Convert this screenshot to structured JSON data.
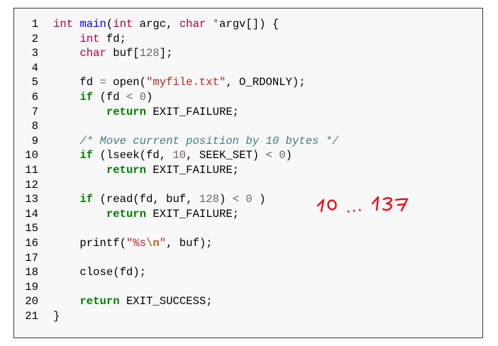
{
  "code": {
    "lines": [
      {
        "n": "1",
        "tokens": [
          {
            "t": "int",
            "c": "t-type"
          },
          {
            "t": " ",
            "c": ""
          },
          {
            "t": "main",
            "c": "t-fn"
          },
          {
            "t": "(",
            "c": ""
          },
          {
            "t": "int",
            "c": "t-type"
          },
          {
            "t": " argc, ",
            "c": ""
          },
          {
            "t": "char",
            "c": "t-type"
          },
          {
            "t": " ",
            "c": ""
          },
          {
            "t": "*",
            "c": "t-op"
          },
          {
            "t": "argv[]) {",
            "c": ""
          }
        ]
      },
      {
        "n": "2",
        "tokens": [
          {
            "t": "    ",
            "c": ""
          },
          {
            "t": "int",
            "c": "t-type"
          },
          {
            "t": " fd;",
            "c": ""
          }
        ]
      },
      {
        "n": "3",
        "tokens": [
          {
            "t": "    ",
            "c": ""
          },
          {
            "t": "char",
            "c": "t-type"
          },
          {
            "t": " buf[",
            "c": ""
          },
          {
            "t": "128",
            "c": "t-num"
          },
          {
            "t": "];",
            "c": ""
          }
        ]
      },
      {
        "n": "4",
        "tokens": []
      },
      {
        "n": "5",
        "tokens": [
          {
            "t": "    fd ",
            "c": ""
          },
          {
            "t": "=",
            "c": "t-op"
          },
          {
            "t": " open(",
            "c": ""
          },
          {
            "t": "\"myfile.txt\"",
            "c": "t-str"
          },
          {
            "t": ", O_RDONLY);",
            "c": ""
          }
        ]
      },
      {
        "n": "6",
        "tokens": [
          {
            "t": "    ",
            "c": ""
          },
          {
            "t": "if",
            "c": "t-kw"
          },
          {
            "t": " (fd ",
            "c": ""
          },
          {
            "t": "<",
            "c": "t-op"
          },
          {
            "t": " ",
            "c": ""
          },
          {
            "t": "0",
            "c": "t-num"
          },
          {
            "t": ")",
            "c": ""
          }
        ]
      },
      {
        "n": "7",
        "tokens": [
          {
            "t": "        ",
            "c": ""
          },
          {
            "t": "return",
            "c": "t-kw"
          },
          {
            "t": " EXIT_FAILURE;",
            "c": ""
          }
        ]
      },
      {
        "n": "8",
        "tokens": []
      },
      {
        "n": "9",
        "tokens": [
          {
            "t": "    ",
            "c": ""
          },
          {
            "t": "/* Move current position by 10 bytes */",
            "c": "t-com"
          }
        ]
      },
      {
        "n": "10",
        "tokens": [
          {
            "t": "    ",
            "c": ""
          },
          {
            "t": "if",
            "c": "t-kw"
          },
          {
            "t": " (lseek(fd, ",
            "c": ""
          },
          {
            "t": "10",
            "c": "t-num"
          },
          {
            "t": ", SEEK_SET) ",
            "c": ""
          },
          {
            "t": "<",
            "c": "t-op"
          },
          {
            "t": " ",
            "c": ""
          },
          {
            "t": "0",
            "c": "t-num"
          },
          {
            "t": ")",
            "c": ""
          }
        ]
      },
      {
        "n": "11",
        "tokens": [
          {
            "t": "        ",
            "c": ""
          },
          {
            "t": "return",
            "c": "t-kw"
          },
          {
            "t": " EXIT_FAILURE;",
            "c": ""
          }
        ]
      },
      {
        "n": "12",
        "tokens": []
      },
      {
        "n": "13",
        "tokens": [
          {
            "t": "    ",
            "c": ""
          },
          {
            "t": "if",
            "c": "t-kw"
          },
          {
            "t": " (read(fd, buf, ",
            "c": ""
          },
          {
            "t": "128",
            "c": "t-num"
          },
          {
            "t": ") ",
            "c": ""
          },
          {
            "t": "<",
            "c": "t-op"
          },
          {
            "t": " ",
            "c": ""
          },
          {
            "t": "0",
            "c": "t-num"
          },
          {
            "t": " )",
            "c": ""
          }
        ]
      },
      {
        "n": "14",
        "tokens": [
          {
            "t": "        ",
            "c": ""
          },
          {
            "t": "return",
            "c": "t-kw"
          },
          {
            "t": " EXIT_FAILURE;",
            "c": ""
          }
        ]
      },
      {
        "n": "15",
        "tokens": []
      },
      {
        "n": "16",
        "tokens": [
          {
            "t": "    printf(",
            "c": ""
          },
          {
            "t": "\"%s",
            "c": "t-str"
          },
          {
            "t": "\\n",
            "c": "t-esc"
          },
          {
            "t": "\"",
            "c": "t-str"
          },
          {
            "t": ", buf);",
            "c": ""
          }
        ]
      },
      {
        "n": "17",
        "tokens": []
      },
      {
        "n": "18",
        "tokens": [
          {
            "t": "    close(fd);",
            "c": ""
          }
        ]
      },
      {
        "n": "19",
        "tokens": []
      },
      {
        "n": "20",
        "tokens": [
          {
            "t": "    ",
            "c": ""
          },
          {
            "t": "return",
            "c": "t-kw"
          },
          {
            "t": " EXIT_SUCCESS;",
            "c": ""
          }
        ]
      },
      {
        "n": "21",
        "tokens": [
          {
            "t": "}",
            "c": ""
          }
        ]
      }
    ]
  },
  "annotation": {
    "text": "10 ... 137",
    "color": "#e8101a"
  },
  "colors": {
    "type": "#b00040",
    "function": "#0000ff",
    "keyword": "#008000",
    "string": "#ba2121",
    "number": "#666666",
    "comment": "#408080",
    "background": "#f8f8f8",
    "border": "#3a3a3a"
  }
}
